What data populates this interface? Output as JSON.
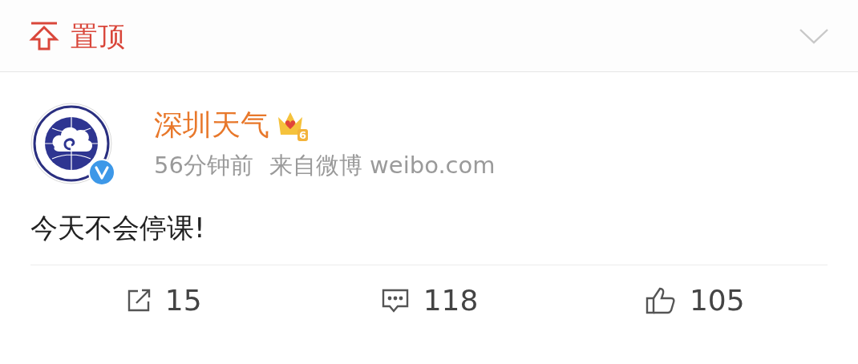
{
  "pinned": {
    "label": "置顶"
  },
  "post": {
    "author": "深圳天气",
    "member_level": "6",
    "verified": true,
    "time": "56分钟前",
    "source": "来自微博 weibo.com",
    "text": "今天不会停课!"
  },
  "actions": [
    {
      "kind": "repost",
      "count": "15"
    },
    {
      "kind": "comment",
      "count": "118"
    },
    {
      "kind": "like",
      "count": "105"
    }
  ]
}
